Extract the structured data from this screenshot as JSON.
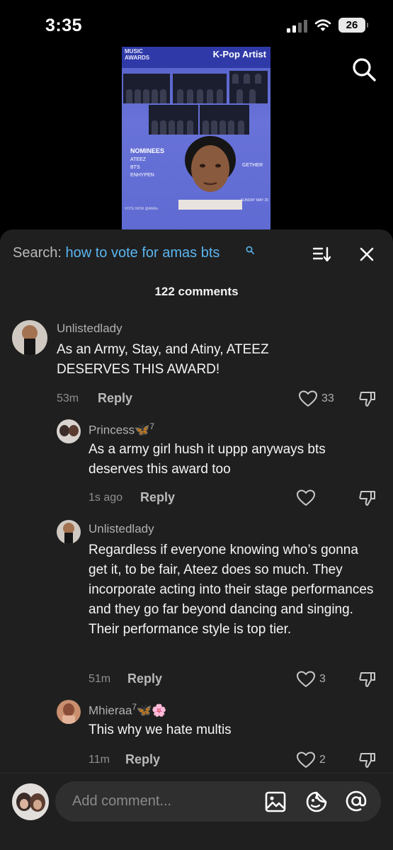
{
  "status": {
    "time": "3:35",
    "battery": "26"
  },
  "video": {
    "logo": "MUSIC\nAWARDS",
    "title": "K-Pop Artist",
    "nominees_heading": "NOMINEES",
    "nominees": [
      "ATEEZ",
      "BTS",
      "ENHYPEN"
    ],
    "together_fragment": "GETHER",
    "vote_line": "VOTE NOW @AMAs",
    "date_line": "SUNDAY MAY 26"
  },
  "comments_panel": {
    "search_label": "Search:",
    "search_query": "how to vote for amas bts",
    "count": "122 comments",
    "comments": [
      {
        "user": "Unlistedlady",
        "badge": "",
        "text": "As an Army, Stay, and Atiny, ATEEZ DESERVES THIS AWARD!",
        "time": "53m",
        "reply": "Reply",
        "likes": "33"
      },
      {
        "user": "Princess🦋",
        "badge": "7",
        "text": "As a army girl hush it uppp anyways bts deserves this award too",
        "time": "1s ago",
        "reply": "Reply",
        "likes": ""
      },
      {
        "user": "Unlistedlady",
        "badge": "",
        "text": "Regardless if everyone knowing who’s gonna get it, to be fair, Ateez does so much. They incorporate acting into their stage performances and they go far beyond dancing and singing. Their performance style is top tier.",
        "time": "51m",
        "reply": "Reply",
        "likes": "3"
      },
      {
        "user": "Mhieraa",
        "badge": "7",
        "suffix": "🦋🌸",
        "text": "This why we hate multis",
        "time": "11m",
        "reply": "Reply",
        "likes": "2"
      }
    ]
  },
  "composer": {
    "placeholder": "Add comment..."
  },
  "colors": {
    "sheet": "#1f1f1f",
    "accent_blue": "#5ab5f0",
    "muted_text": "#b0b0b0"
  }
}
